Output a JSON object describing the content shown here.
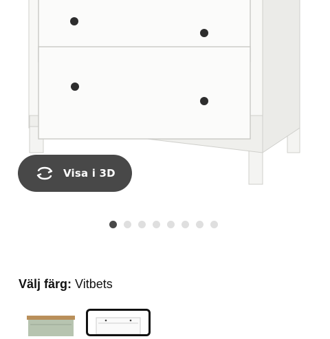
{
  "view3d": {
    "label": "Visa i 3D",
    "icon": "rotate-360-icon"
  },
  "carousel": {
    "total": 8,
    "active_index": 0
  },
  "color_picker": {
    "prefix": "Välj färg:",
    "selected": "Vitbets",
    "swatches": [
      {
        "name": "grey-green-swatch",
        "selected": false
      },
      {
        "name": "white-stain-swatch",
        "selected": true
      }
    ]
  },
  "colors": {
    "button_bg": "#484848",
    "dot_active": "#484848",
    "dot_inactive": "#dfdfdf"
  }
}
